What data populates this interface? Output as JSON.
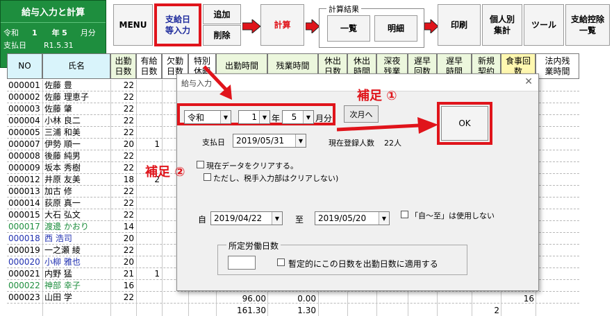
{
  "panel": {
    "title": "給与入力と計算",
    "era_label": "令和",
    "year_value": "1",
    "year_label": "年",
    "month_value": "5",
    "month_label": "月分",
    "payday_label": "支払日",
    "payday_value": "R1.5.31"
  },
  "toolbar": {
    "menu": "MENU",
    "pay_input_line1": "支給日",
    "pay_input_line2": "等入力",
    "add": "追加",
    "delete": "削除",
    "calc": "計算",
    "results_group": "計算結果",
    "list": "一覧",
    "detail": "明細",
    "print": "印刷",
    "per_person_line1": "個人別",
    "per_person_line2": "集計",
    "tools": "ツール",
    "deduction_line1": "支給控除",
    "deduction_line2": "一覧"
  },
  "grid": {
    "headers": [
      {
        "l1": "NO",
        "l2": ""
      },
      {
        "l1": "氏名",
        "l2": ""
      },
      {
        "l1": "出勤",
        "l2": "日数"
      },
      {
        "l1": "有給",
        "l2": "日数"
      },
      {
        "l1": "欠勤",
        "l2": "日数"
      },
      {
        "l1": "特別",
        "l2": "休暇"
      },
      {
        "l1": "出勤時間",
        "l2": ""
      },
      {
        "l1": "残業時間",
        "l2": ""
      },
      {
        "l1": "休出",
        "l2": "日数"
      },
      {
        "l1": "休出",
        "l2": "時間"
      },
      {
        "l1": "深夜",
        "l2": "残業"
      },
      {
        "l1": "遅早",
        "l2": "回数"
      },
      {
        "l1": "遅早",
        "l2": "時間"
      },
      {
        "l1": "新規",
        "l2": "契約"
      },
      {
        "l1": "食事回",
        "l2": "数"
      },
      {
        "l1": "法内残",
        "l2": "業時間"
      }
    ],
    "rows": [
      {
        "no": "000001",
        "name": "佐藤 豊",
        "days": "22",
        "paid": "",
        "color": ""
      },
      {
        "no": "000002",
        "name": "佐藤 理恵子",
        "days": "22",
        "paid": "",
        "color": ""
      },
      {
        "no": "000003",
        "name": "佐藤 肇",
        "days": "22",
        "paid": "",
        "color": ""
      },
      {
        "no": "000004",
        "name": "小林 良二",
        "days": "22",
        "paid": "",
        "color": ""
      },
      {
        "no": "000005",
        "name": "三浦 和美",
        "days": "22",
        "paid": "",
        "color": ""
      },
      {
        "no": "000007",
        "name": "伊勢 順一",
        "days": "20",
        "paid": "1",
        "color": ""
      },
      {
        "no": "000008",
        "name": "後藤 純男",
        "days": "22",
        "paid": "",
        "color": ""
      },
      {
        "no": "000009",
        "name": "坂本 秀樹",
        "days": "22",
        "paid": "",
        "color": ""
      },
      {
        "no": "000012",
        "name": "井原 友美",
        "days": "18",
        "paid": "2",
        "color": ""
      },
      {
        "no": "000013",
        "name": "加古 修",
        "days": "22",
        "paid": "",
        "color": ""
      },
      {
        "no": "000014",
        "name": "荻原 真一",
        "days": "22",
        "paid": "",
        "color": ""
      },
      {
        "no": "000015",
        "name": "大石 弘文",
        "days": "22",
        "paid": "",
        "color": ""
      },
      {
        "no": "000017",
        "name": "渡邊 かおり",
        "days": "14",
        "paid": "",
        "color": "green"
      },
      {
        "no": "000018",
        "name": "西 浩司",
        "days": "20",
        "paid": "",
        "color": "blue"
      },
      {
        "no": "000019",
        "name": "一之瀬 綾",
        "days": "22",
        "paid": "",
        "color": ""
      },
      {
        "no": "000020",
        "name": "小柳 雅也",
        "days": "20",
        "paid": "",
        "color": "blue"
      },
      {
        "no": "000021",
        "name": "内野 猛",
        "days": "21",
        "paid": "1",
        "color": ""
      },
      {
        "no": "000022",
        "name": "神部 幸子",
        "days": "16",
        "paid": "",
        "color": "green"
      },
      {
        "no": "000023",
        "name": "山田 学",
        "days": "22",
        "paid": "",
        "color": ""
      }
    ],
    "row22_work_hours": "96.00",
    "row22_overtime": "0.00",
    "row22_meals": "16",
    "row23_work_hours": "161.30",
    "row23_overtime": "1.30",
    "row23_new_contract": "2"
  },
  "dialog": {
    "title": "給与入力",
    "close": "✕",
    "era_value": "令和",
    "year_value": "1",
    "year_unit": "年",
    "month_value": "5",
    "month_unit": "月分",
    "next_month": "次月へ",
    "ok": "OK",
    "payday_label": "支払日",
    "payday_value": "2019/05/31",
    "registered_label": "現在登録人数",
    "registered_value": "22人",
    "clear_data": "現在データをクリアする。",
    "clear_note": "ただし、税手入力部はクリアしない)",
    "from_label": "自",
    "from_value": "2019/04/22",
    "to_label": "至",
    "to_value": "2019/05/20",
    "no_range": "「自～至」は使用しない",
    "work_days_group": "所定労働日数",
    "work_days_value": "",
    "apply_days": "暫定的にこの日数を出勤日数に適用する"
  },
  "annotations": {
    "note1": "補足 ①",
    "note2": "補足 ②"
  },
  "colors": {
    "panel_green": "#1e8e3e",
    "highlight_red": "#e0141b",
    "header_cyan": "#d9f4fb",
    "header_green": "#ecf7dd",
    "header_yellow": "#fff8b0",
    "blue_text": "#2030b0"
  }
}
